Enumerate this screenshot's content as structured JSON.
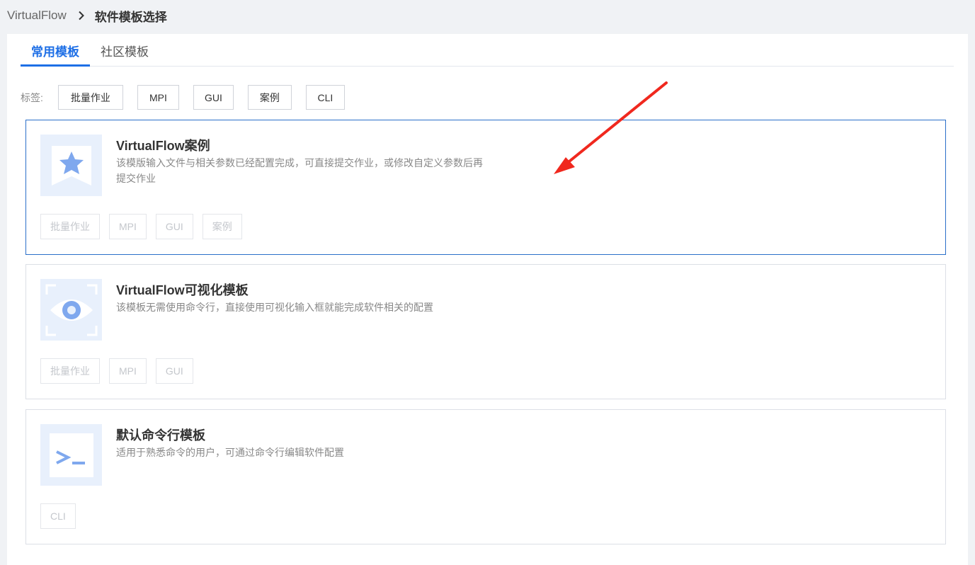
{
  "breadcrumb": {
    "root": "VirtualFlow",
    "current": "软件模板选择"
  },
  "tabs": [
    {
      "label": "常用模板",
      "active": true
    },
    {
      "label": "社区模板",
      "active": false
    }
  ],
  "filter": {
    "label": "标签:",
    "tags": [
      "批量作业",
      "MPI",
      "GUI",
      "案例",
      "CLI"
    ]
  },
  "templates": [
    {
      "title": "VirtualFlow案例",
      "description": "该模版输入文件与相关参数已经配置完成，可直接提交作业，或修改自定义参数后再提交作业",
      "icon": "star-bookmark-icon",
      "tags": [
        "批量作业",
        "MPI",
        "GUI",
        "案例"
      ],
      "selected": true
    },
    {
      "title": "VirtualFlow可视化模板",
      "description": "该模板无需使用命令行，直接使用可视化输入框就能完成软件相关的配置",
      "icon": "eye-icon",
      "tags": [
        "批量作业",
        "MPI",
        "GUI"
      ],
      "selected": false
    },
    {
      "title": "默认命令行模板",
      "description": "适用于熟悉命令的用户，可通过命令行编辑软件配置",
      "icon": "terminal-icon",
      "tags": [
        "CLI"
      ],
      "selected": false
    }
  ],
  "colors": {
    "accent": "#1e6fe6",
    "selected_border": "#2a6fc9",
    "icon_bg": "#e8f0fc",
    "icon_fg": "#7fa8ee",
    "annotation_arrow": "#f0281e"
  },
  "annotation": {
    "icon": "red-arrow-icon"
  }
}
